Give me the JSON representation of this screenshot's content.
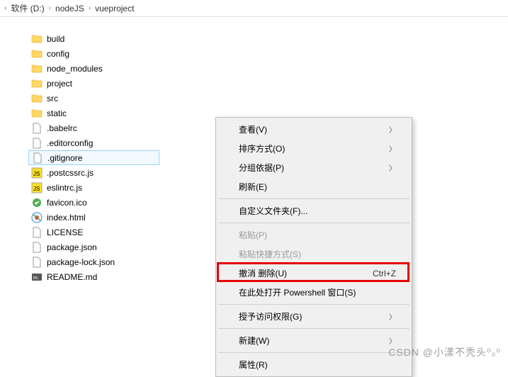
{
  "breadcrumb": {
    "root": "软件 (D:)",
    "p1": "nodeJS",
    "p2": "vueproject"
  },
  "files": [
    {
      "name": "build",
      "type": "folder"
    },
    {
      "name": "config",
      "type": "folder"
    },
    {
      "name": "node_modules",
      "type": "folder"
    },
    {
      "name": "project",
      "type": "folder"
    },
    {
      "name": "src",
      "type": "folder"
    },
    {
      "name": "static",
      "type": "folder"
    },
    {
      "name": ".babelrc",
      "type": "file"
    },
    {
      "name": ".editorconfig",
      "type": "file"
    },
    {
      "name": ".gitignore",
      "type": "file",
      "selected": true
    },
    {
      "name": ".postcssrc.js",
      "type": "js"
    },
    {
      "name": "eslintrc.js",
      "type": "js"
    },
    {
      "name": "favicon.ico",
      "type": "ico"
    },
    {
      "name": "index.html",
      "type": "html"
    },
    {
      "name": "LICENSE",
      "type": "file"
    },
    {
      "name": "package.json",
      "type": "file"
    },
    {
      "name": "package-lock.json",
      "type": "file"
    },
    {
      "name": "README.md",
      "type": "md"
    }
  ],
  "menu": {
    "view": "查看(V)",
    "sort": "排序方式(O)",
    "group": "分组依据(P)",
    "refresh": "刷新(E)",
    "customize": "自定义文件夹(F)...",
    "paste": "粘贴(P)",
    "paste_shortcut": "粘贴快捷方式(S)",
    "undo": "撤消 删除(U)",
    "undo_key": "Ctrl+Z",
    "powershell": "在此处打开 Powershell 窗口(S)",
    "grant": "授予访问权限(G)",
    "new": "新建(W)",
    "properties": "属性(R)"
  },
  "watermark": "CSDN @小漾不秃头⁰₀⁰"
}
